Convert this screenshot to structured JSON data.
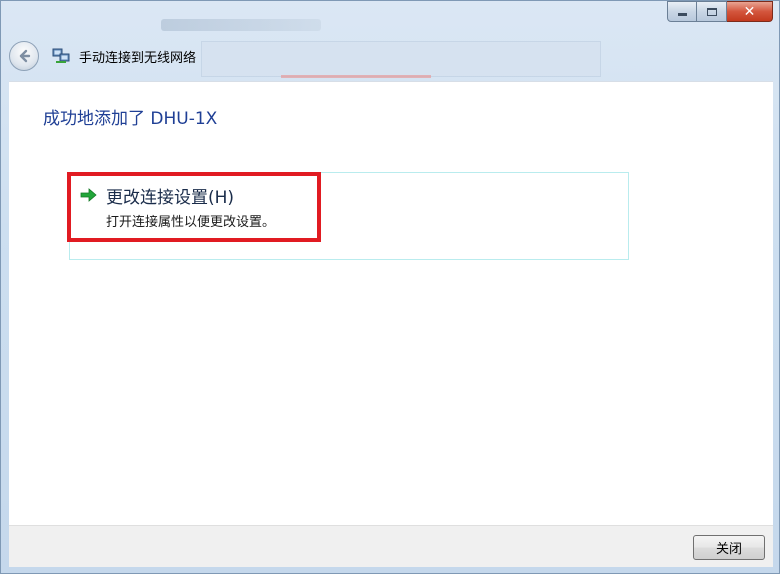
{
  "window": {
    "title": "手动连接到无线网络",
    "controls": {
      "minimize_icon": "minimize-icon",
      "maximize_icon": "maximize-icon",
      "close_icon": "close-icon",
      "close_glyph": "✕"
    }
  },
  "content": {
    "success_message": "成功地添加了 DHU-1X",
    "option": {
      "title": "更改连接设置(H)",
      "description": "打开连接属性以便更改设置。",
      "icon": "green-arrow-icon"
    },
    "highlight_color": "#e11b22"
  },
  "footer": {
    "close_label": "关闭"
  },
  "colors": {
    "accent_title": "#1f3f95",
    "option_border": "#b9ecee"
  }
}
